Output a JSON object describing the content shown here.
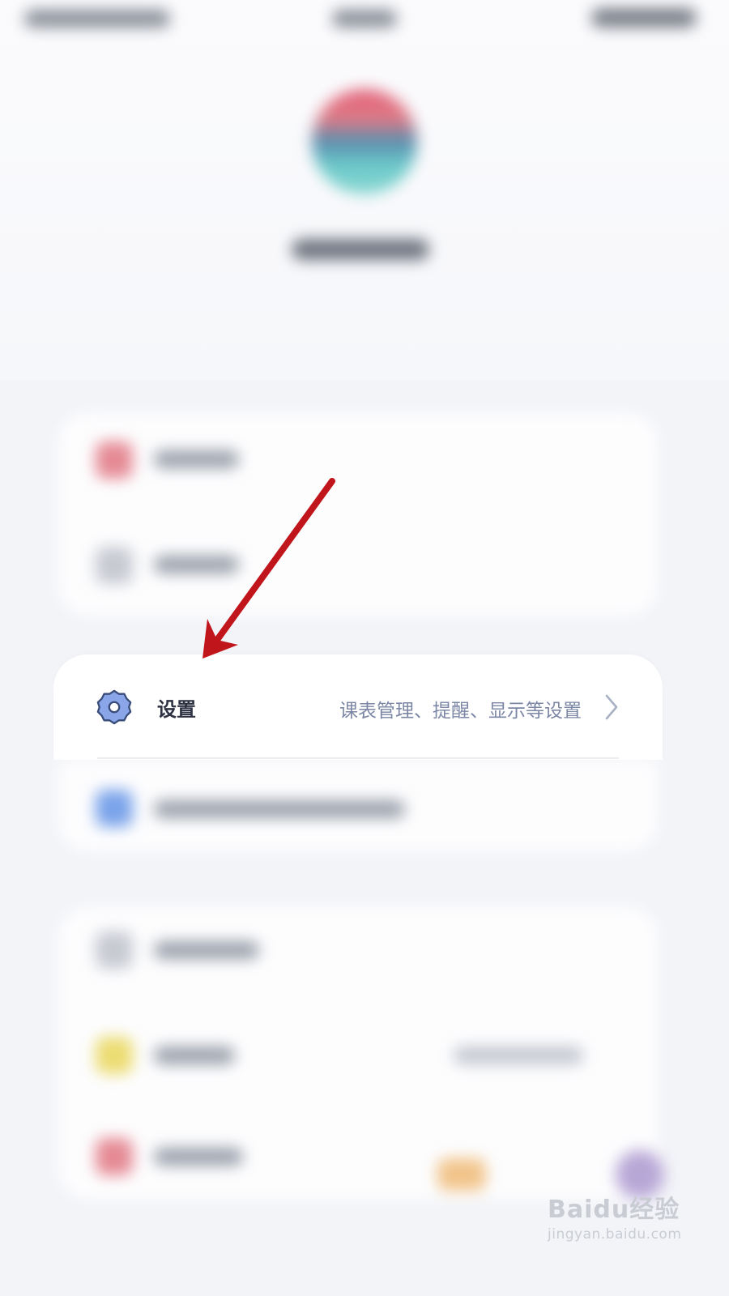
{
  "settings_row": {
    "title": "设置",
    "description": "课表管理、提醒、显示等设置"
  },
  "watermark": {
    "logo": "Baidu经验",
    "url": "jingyan.baidu.com"
  },
  "colors": {
    "annotation_arrow": "#c0161b",
    "gear_fill": "#8aa6e8",
    "gear_outline": "#3a4d7a"
  },
  "icons": [
    "gear-icon",
    "chevron-right-icon",
    "annotation-arrow"
  ]
}
